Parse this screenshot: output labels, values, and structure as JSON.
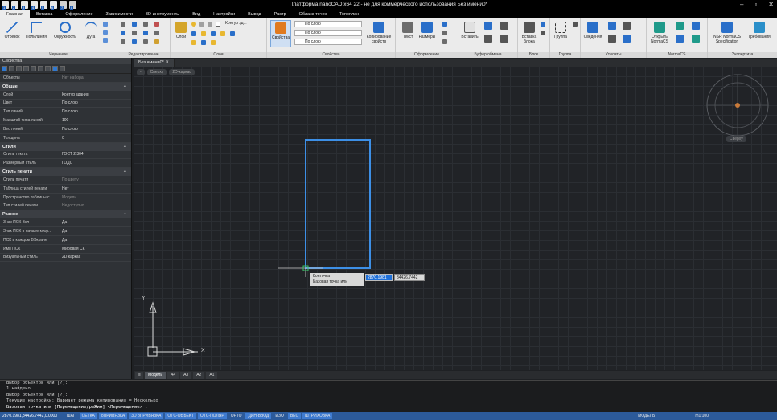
{
  "window": {
    "title": "Платформа nanoCAD x64 22 - не для коммерческого использования Без имени0*"
  },
  "qat_badges": [
    "1",
    "2",
    "3",
    "4",
    "5",
    "6",
    "7",
    "8"
  ],
  "ribbon_tabs": [
    "Главная",
    "Вставка",
    "Оформление",
    "Зависимости",
    "3D-инструменты",
    "Вид",
    "Настройки",
    "Вывод",
    "Растр",
    "Облака точек",
    "Топоплан"
  ],
  "ribbon": {
    "groups": {
      "draw": "Черчение",
      "edit": "Редактирование",
      "layers": "Слои",
      "props": "Свойства",
      "format": "Оформление",
      "clipboard": "Буфер обмена",
      "block": "Блок",
      "group": "Группа",
      "utils": "Утилиты",
      "normacs": "NormaCS",
      "expert": "Экспертиза"
    },
    "draw_buttons": [
      "Отрезок",
      "Полилиния",
      "Окружность",
      "Дуга"
    ],
    "layer_combo": "Контур зд...",
    "layers_label": "Слои",
    "props_button": "Свойства",
    "bylayer": "По слою",
    "copy_props": "Копирование свойств",
    "text_btn": "Текст",
    "dims_btn": "Размеры",
    "paste_btn": "Вставить",
    "insert_block": "Вставка блока",
    "group_btn": "Группа",
    "info_btn": "Сведения",
    "open_normacs": "Открыть NormaCS",
    "nsr": "NSR NormaCS Specification",
    "requirements": "Требования"
  },
  "properties": {
    "title": "Свойства",
    "filter_key": "Объекты",
    "filter_val": "Нет набора",
    "sections": [
      {
        "name": "Общие",
        "rows": [
          [
            "Слой",
            "Контур здания"
          ],
          [
            "Цвет",
            "По слою"
          ],
          [
            "Тип линий",
            "По слою"
          ],
          [
            "Масштаб типа линий",
            "100"
          ],
          [
            "Вес линий",
            "По слою"
          ],
          [
            "Толщина",
            "0"
          ]
        ]
      },
      {
        "name": "Стили",
        "rows": [
          [
            "Стиль текста",
            "ГОСТ 2.304"
          ],
          [
            "Размерный стиль",
            "ГОДС"
          ]
        ]
      },
      {
        "name": "Стиль печати",
        "rows": [
          [
            "Стиль печати",
            "По цвету"
          ],
          [
            "Таблица стилей печати",
            "Нет"
          ],
          [
            "Пространство таблицы с...",
            "Модель"
          ],
          [
            "Тип стилей печати",
            "Недоступно"
          ]
        ]
      },
      {
        "name": "Разное",
        "rows": [
          [
            "Знак ПСК Вкл",
            "Да"
          ],
          [
            "Знак ПСК в начале коор...",
            "Да"
          ],
          [
            "ПСК в каждом ВЭкране",
            "Да"
          ],
          [
            "Имя ПСК",
            "Мировая СК"
          ],
          [
            "Визуальный стиль",
            "2D каркас"
          ]
        ]
      }
    ]
  },
  "doc_tab": "Без имени0*",
  "view_chips": [
    "-",
    "Сверху",
    "2D-каркас"
  ],
  "viewcube_label": "Сверху",
  "tooltip": {
    "title": "Конточка",
    "prompt": "Базовая точка или",
    "x": "2870.1981",
    "y": "34426.7442"
  },
  "ucs": {
    "x": "X",
    "y": "Y"
  },
  "layout_tabs": [
    "Модель",
    "A4",
    "A3",
    "A2",
    "A1"
  ],
  "command_lines": [
    "Выбор объектов или [?]:",
    "1 найдено",
    "Выбор объектов или [?]:",
    "Текущие настройки: Вариант режима копирования = Несколько",
    "Базовая точка или [Перемещение/реЖим] <Перемещение> :"
  ],
  "status": {
    "coords": "2870.1981,34426.7442,0.0000",
    "toggles": [
      "ШАГ",
      "СЕТКА",
      "оПРИВЯЗКА",
      "3D оПРИВЯЗКА",
      "ОТС-ОБЪЕКТ",
      "ОТС-ПОЛЯР",
      "ОРТО",
      "ДИН-ВВОД",
      "ИЗО",
      "ВЕС",
      "ШТРИХОВКА"
    ],
    "active": [
      "СЕТКА",
      "оПРИВЯЗКА",
      "3D оПРИВЯЗКА",
      "ОТС-ОБЪЕКТ",
      "ОТС-ПОЛЯР",
      "ДИН-ВВОД",
      "ВЕС",
      "ШТРИХОВКА"
    ],
    "model": "МОДЕЛЬ",
    "scale": "m1:100"
  },
  "colors": {
    "accent": "#2f78d0",
    "rect": "#3d8fe6",
    "canvas": "#212327",
    "status": "#2c5a9a"
  }
}
